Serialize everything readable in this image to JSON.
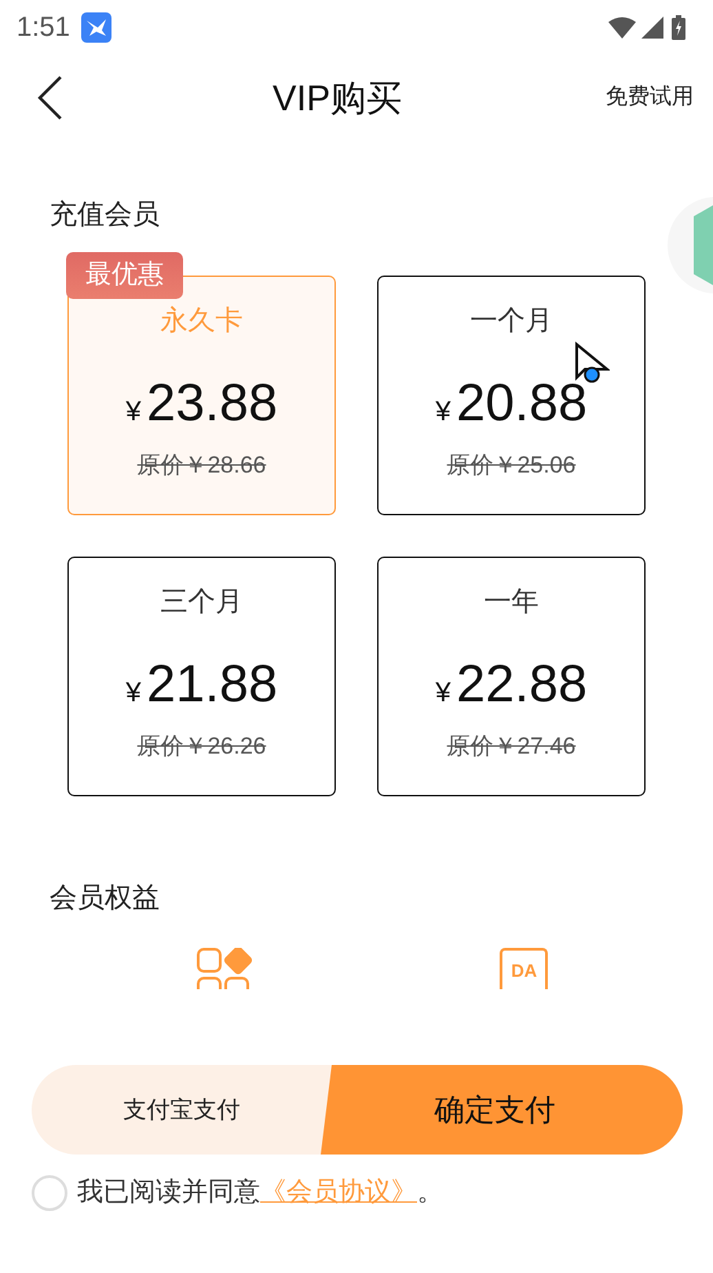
{
  "status_bar": {
    "time": "1:51"
  },
  "header": {
    "title": "VIP购买",
    "action": "免费试用"
  },
  "section_title": "充值会员",
  "plans": [
    {
      "name": "永久卡",
      "currency": "¥",
      "price": "23.88",
      "original_price": "原价￥28.66",
      "selected": true,
      "badge": "最优惠"
    },
    {
      "name": "一个月",
      "currency": "¥",
      "price": "20.88",
      "original_price": "原价￥25.06",
      "selected": false
    },
    {
      "name": "三个月",
      "currency": "¥",
      "price": "21.88",
      "original_price": "原价￥26.26",
      "selected": false
    },
    {
      "name": "一年",
      "currency": "¥",
      "price": "22.88",
      "original_price": "原价￥27.46",
      "selected": false
    }
  ],
  "benefits": {
    "title": "会员权益",
    "items": [
      {
        "kind": "grid"
      },
      {
        "kind": "tag",
        "label": "DA"
      }
    ]
  },
  "payment": {
    "method": "支付宝支付",
    "confirm": "确定支付"
  },
  "agreement": {
    "checked": false,
    "text": "我已阅读并同意",
    "link": "《会员协议》",
    "end": "。"
  }
}
